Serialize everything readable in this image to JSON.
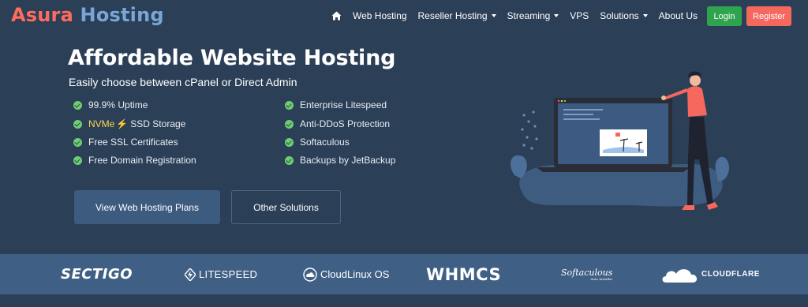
{
  "brand": {
    "part1": "Asura",
    "part2": "Hosting"
  },
  "nav": {
    "items": [
      {
        "label": "Web Hosting",
        "dropdown": false
      },
      {
        "label": "Reseller Hosting",
        "dropdown": true
      },
      {
        "label": "Streaming",
        "dropdown": true
      },
      {
        "label": "VPS",
        "dropdown": false
      },
      {
        "label": "Solutions",
        "dropdown": true
      },
      {
        "label": "About Us",
        "dropdown": false
      }
    ],
    "home_icon": "home-icon",
    "login": "Login",
    "register": "Register"
  },
  "hero": {
    "title": "Affordable Website Hosting",
    "subtitle": "Easily choose between cPanel or Direct Admin",
    "features_left": [
      "99.9% Uptime",
      "SSD Storage",
      "Free SSL Certificates",
      "Free Domain Registration"
    ],
    "nvme": "NVMe",
    "features_right": [
      "Enterprise Litespeed",
      "Anti-DDoS Protection",
      "Softaculous",
      "Backups by JetBackup"
    ],
    "primary_button": "View Web Hosting Plans",
    "secondary_button": "Other Solutions"
  },
  "partners": {
    "sectigo": "SECTIGO",
    "litespeed": "LITESPEED",
    "cloudlinux": "CloudLinux OS",
    "whmcs": "WHMCS",
    "softaculous": "Softaculous",
    "softaculous_sub": "Auto Installer",
    "cloudflare": "CLOUDFLARE"
  },
  "colors": {
    "background": "#2b3f57",
    "accent_red": "#f6685e",
    "login_green": "#2ea44f",
    "check_green": "#6ccf6f",
    "partner_bar": "#3f5f84"
  }
}
